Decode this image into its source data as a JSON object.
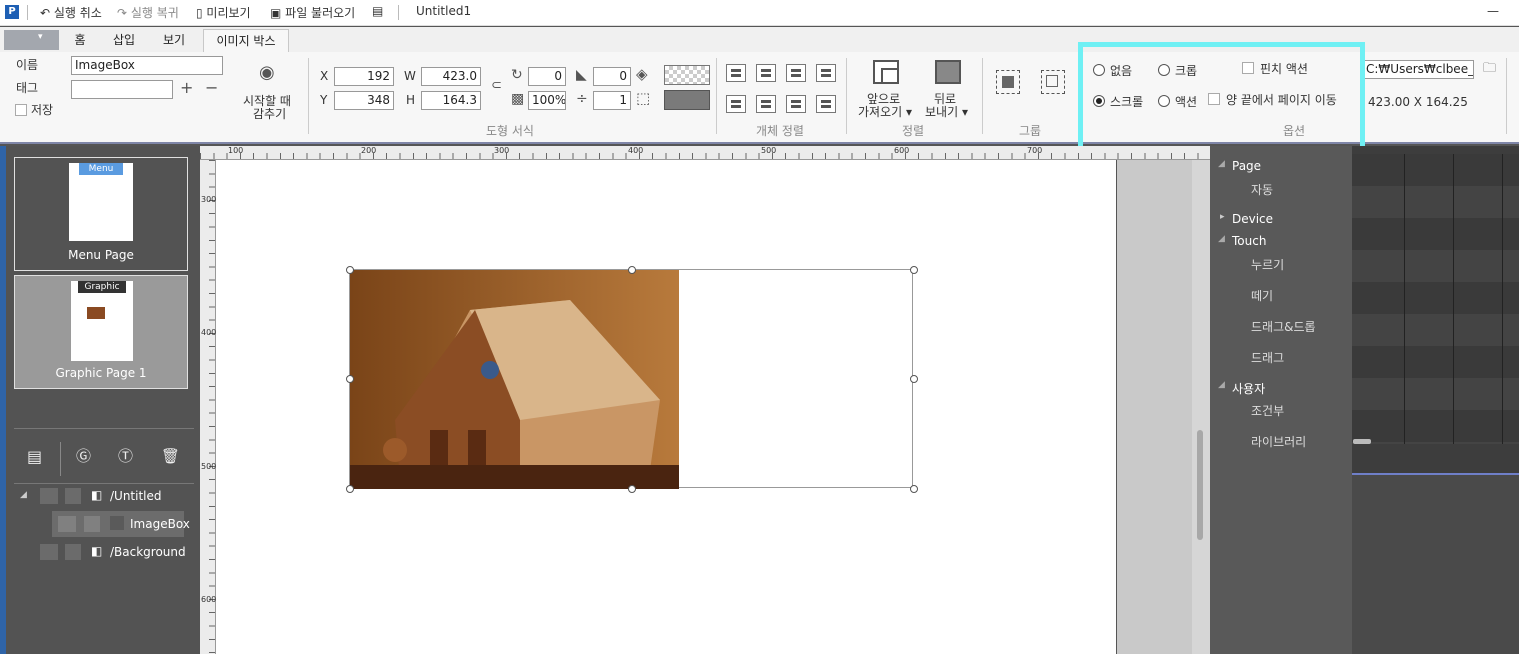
{
  "titlebar": {
    "undo": "실행 취소",
    "redo": "실행 복귀",
    "preview": "미리보기",
    "import_file": "파일 불러오기",
    "doc_title": "Untitled1",
    "minimize": "—"
  },
  "tabs": [
    "홈",
    "삽입",
    "보기",
    "이미지 박스"
  ],
  "ribbon": {
    "name_label": "이름",
    "name_value": "ImageBox",
    "tag_label": "태그",
    "tag_value": "",
    "save_label": "저장",
    "hide_start_line1": "시작할 때",
    "hide_start_line2": "감추기",
    "x_label": "X",
    "x_value": "192",
    "y_label": "Y",
    "y_value": "348",
    "w_label": "W",
    "w_value": "423.0",
    "h_label": "H",
    "h_value": "164.3",
    "rotation_value": "0",
    "corner_value": "0",
    "opacity_value": "100%",
    "border_value": "1",
    "shape_format_label": "도형 서식",
    "align_label": "개체 정렬",
    "bring_front_line1": "앞으로",
    "bring_front_line2": "가져오기",
    "send_back_line1": "뒤로",
    "send_back_line2": "보내기",
    "order_label": "정렬",
    "group_label": "그룹",
    "options": {
      "none": "없음",
      "crop": "크롭",
      "scroll": "스크롤",
      "action": "액션",
      "pinch_action": "핀치 액션",
      "page_move": "양 끝에서 페이지 이동",
      "group_label": "옵션",
      "selected": "scroll"
    },
    "path_value": "C:₩Users₩clbee_pul",
    "size_text": "423.00 X 164.25"
  },
  "pages": [
    {
      "badge": "Menu",
      "caption": "Menu Page"
    },
    {
      "badge": "Graphic",
      "caption": "Graphic Page 1"
    }
  ],
  "layers": [
    {
      "name": "/Untitled"
    },
    {
      "name": "ImageBox"
    },
    {
      "name": "/Background"
    }
  ],
  "ruler": {
    "top": [
      "100",
      "200",
      "300",
      "400",
      "500",
      "600",
      "700"
    ],
    "left": [
      "300",
      "400",
      "500",
      "600"
    ]
  },
  "events": {
    "page": "Page",
    "page_auto": "자동",
    "device": "Device",
    "touch": "Touch",
    "press": "누르기",
    "release": "떼기",
    "drag_drop": "드래그&드롭",
    "drag": "드래그",
    "user": "사용자",
    "conditional": "조건부",
    "library": "라이브러리"
  }
}
